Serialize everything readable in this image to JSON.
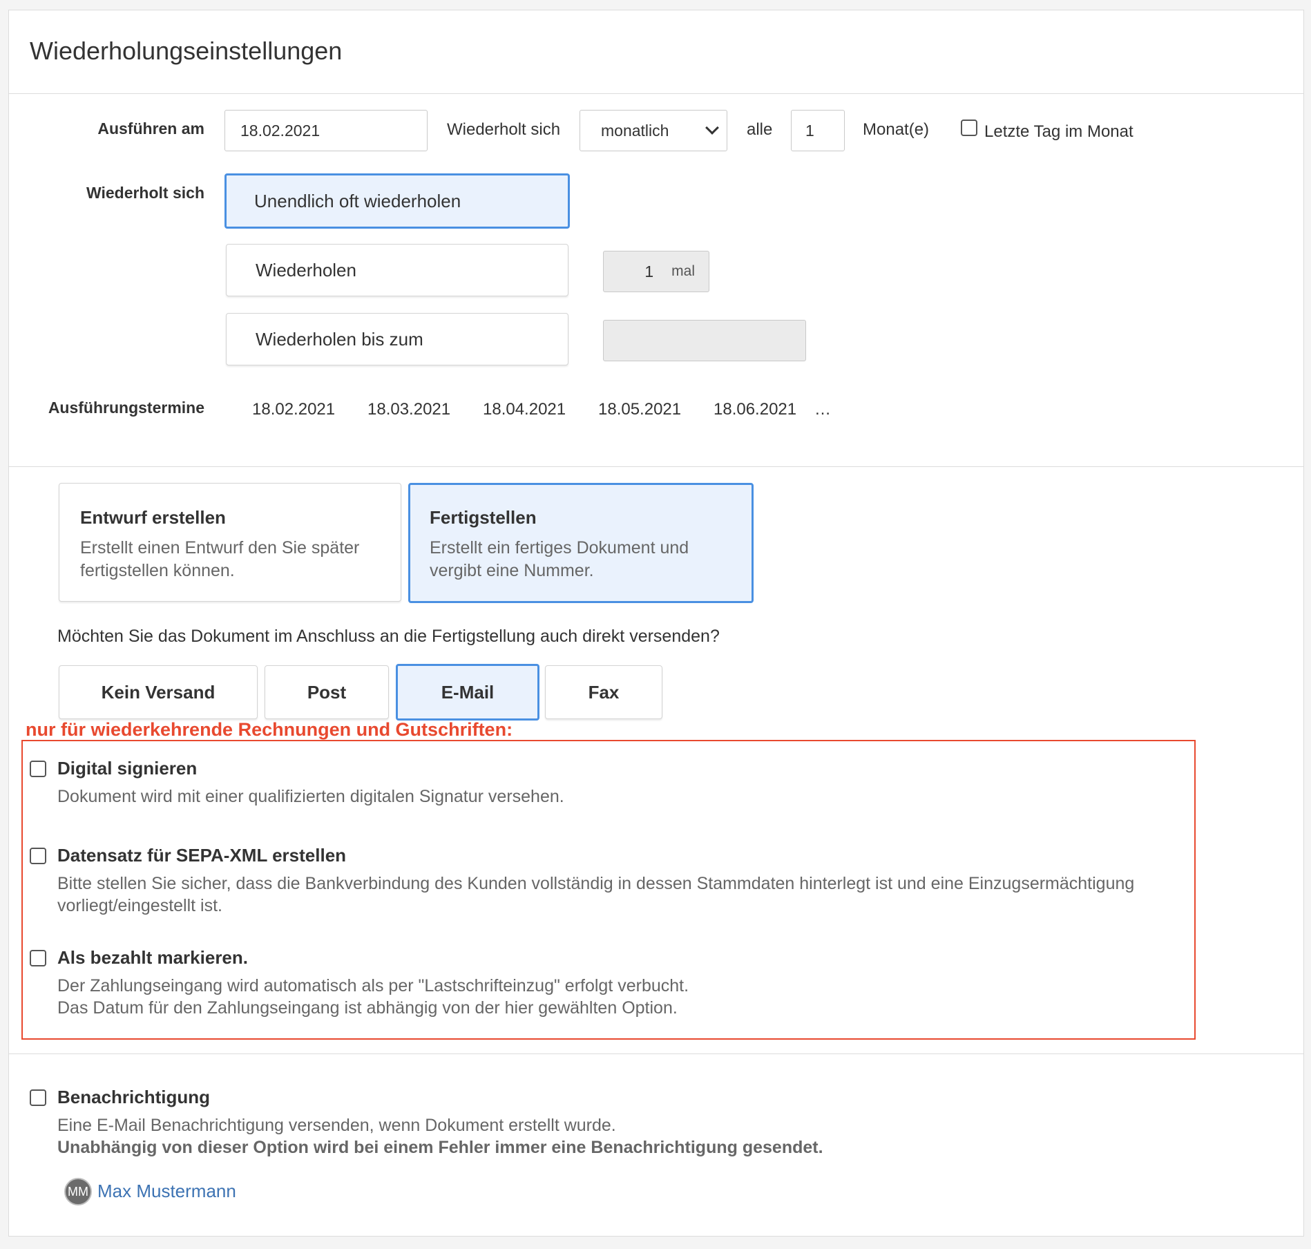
{
  "title": "Wiederholungseinstellungen",
  "execute": {
    "label": "Ausführen am",
    "date": "18.02.2021",
    "repeats_label": "Wiederholt sich",
    "frequency": "monatlich",
    "every_label": "alle",
    "every_value": "1",
    "unit": "Monat(e)",
    "last_day_label": "Letzte Tag im Monat"
  },
  "repeat": {
    "label": "Wiederholt sich",
    "options": [
      {
        "label": "Unendlich oft wiederholen"
      },
      {
        "label": "Wiederholen"
      },
      {
        "label": "Wiederholen bis zum"
      }
    ],
    "count_value": "1",
    "count_unit": "mal",
    "until_value": ""
  },
  "schedule": {
    "label": "Ausführungstermine",
    "dates": [
      "18.02.2021",
      "18.03.2021",
      "18.04.2021",
      "18.05.2021",
      "18.06.2021"
    ],
    "more": "…"
  },
  "mode": {
    "draft": {
      "title": "Entwurf erstellen",
      "desc": "Erstellt einen Entwurf den Sie später fertigstellen können."
    },
    "finalize": {
      "title": "Fertigstellen",
      "desc": "Erstellt ein fertiges Dokument und vergibt eine Nummer."
    }
  },
  "shipping": {
    "question": "Möchten Sie das Dokument im Anschluss an die Fertigstellung auch direkt versenden?",
    "options": [
      "Kein Versand",
      "Post",
      "E-Mail",
      "Fax"
    ],
    "selected": "E-Mail"
  },
  "recurring_note": "nur für wiederkehrende Rechnungen und Gutschriften:",
  "options": {
    "sign": {
      "title": "Digital signieren",
      "desc": "Dokument wird mit einer qualifizierten digitalen Signatur versehen."
    },
    "sepa": {
      "title": "Datensatz für SEPA-XML erstellen",
      "desc1": "Bitte stellen Sie sicher, dass die Bankverbindung des Kunden vollständig in dessen Stammdaten hinterlegt ist und eine Einzugsermächtigung",
      "desc2": "vorliegt/eingestellt ist."
    },
    "paid": {
      "title": "Als bezahlt markieren.",
      "desc1": "Der Zahlungseingang wird automatisch als per \"Lastschrifteinzug\" erfolgt verbucht.",
      "desc2": "Das Datum für den Zahlungseingang ist abhängig von der hier gewählten Option."
    }
  },
  "notification": {
    "title": "Benachrichtigung",
    "desc": "Eine E-Mail Benachrichtigung versenden, wenn Dokument erstellt wurde.",
    "desc_bold": "Unabhängig von dieser Option wird bei einem Fehler immer eine Benachrichtigung gesendet.",
    "user_initials": "MM",
    "user_name": "Max Mustermann"
  },
  "colors": {
    "accent": "#4a90e2",
    "selected_bg": "#eaf2fd",
    "warning": "#e8492f",
    "link": "#3d73b3"
  }
}
